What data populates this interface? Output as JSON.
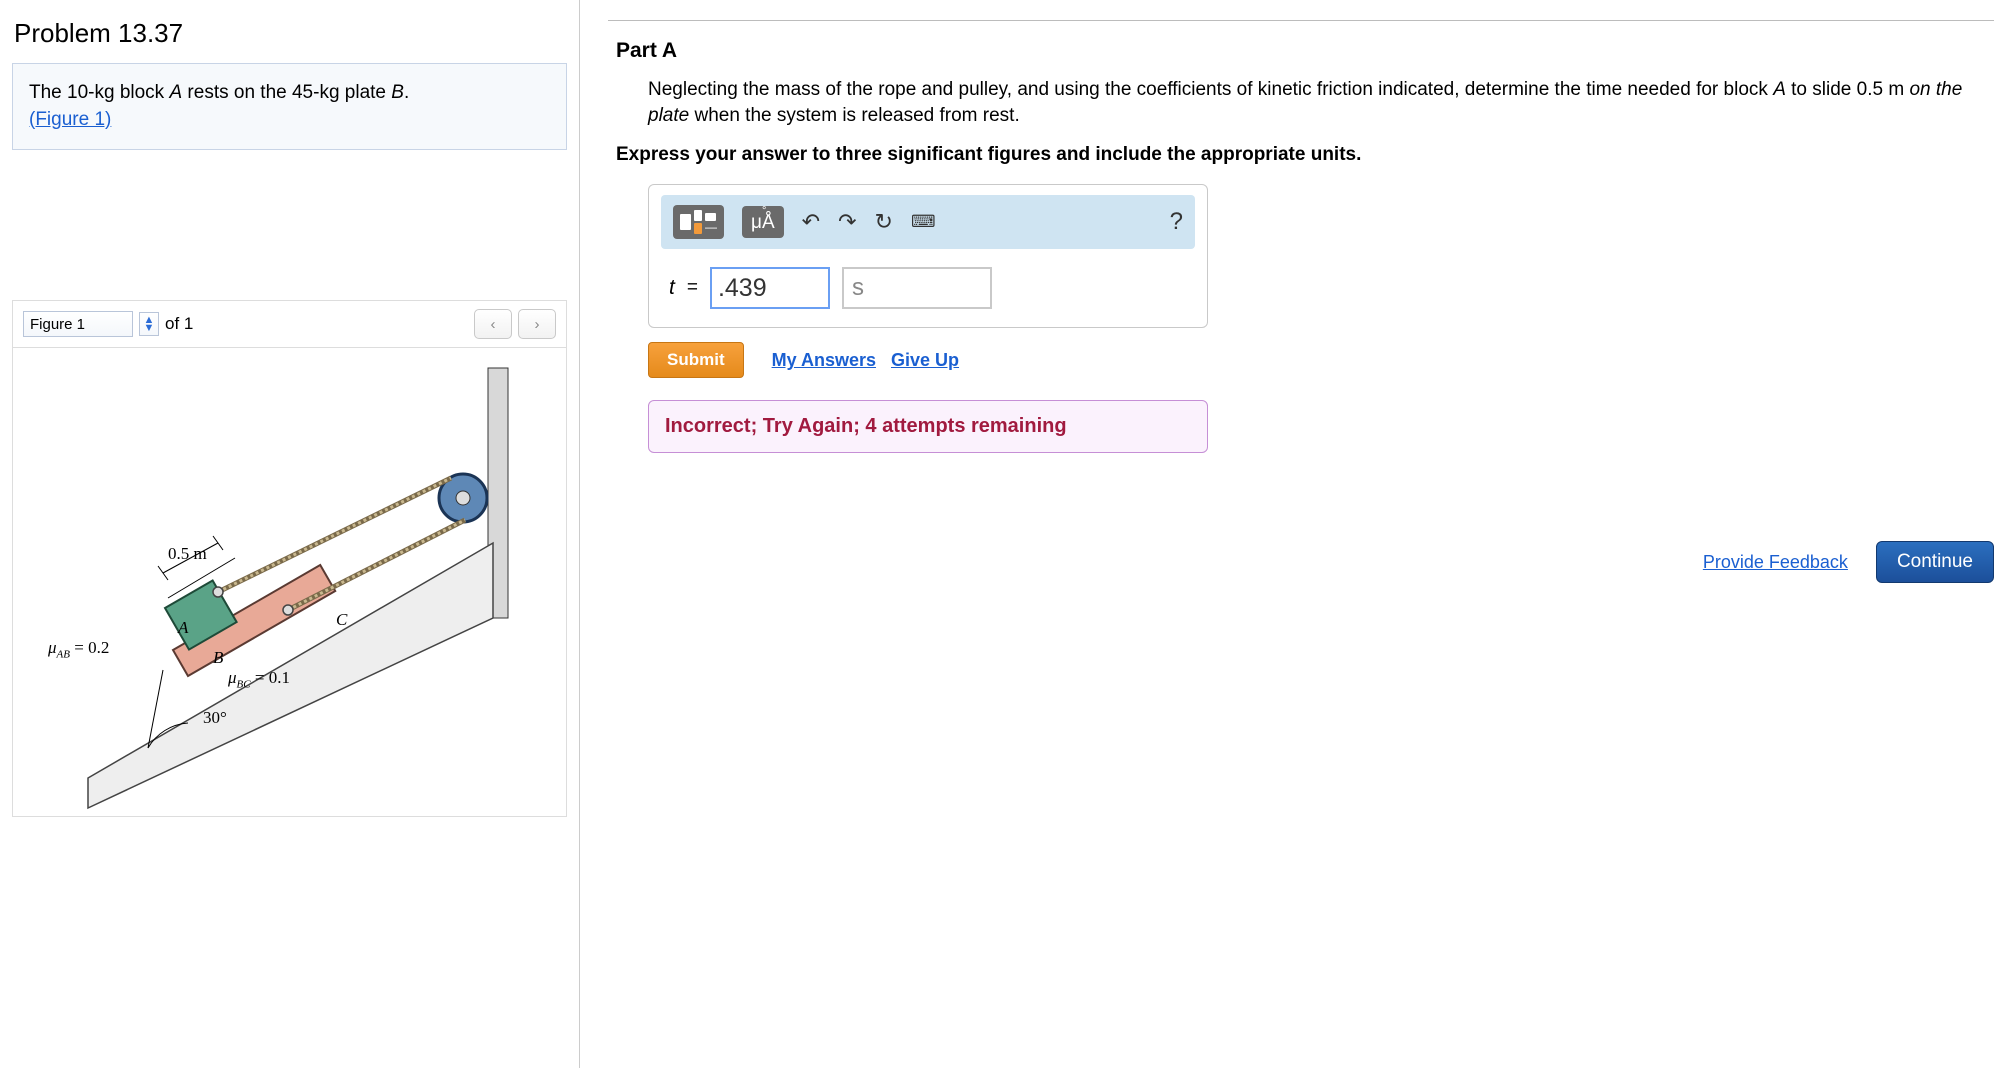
{
  "problem": {
    "title": "Problem 13.37",
    "statement_prefix": "The 10-kg block ",
    "statement_A": "A",
    "statement_mid": " rests on the 45-kg plate ",
    "statement_B": "B",
    "statement_suffix": ".",
    "figure_link": "(Figure 1)"
  },
  "figure_nav": {
    "selector_value": "Figure 1",
    "of_label": "of 1"
  },
  "figure_labels": {
    "distance": "0.5 m",
    "A": "A",
    "B": "B",
    "C": "C",
    "mu_ab": "μ",
    "mu_ab_sub": "AB",
    "mu_ab_val": " = 0.2",
    "mu_bc": "μ",
    "mu_bc_sub": "BC",
    "mu_bc_val": " = 0.1",
    "angle": "30°"
  },
  "part": {
    "label": "Part A",
    "text_1": "Neglecting the mass of the rope and pulley, and using the coefficients of kinetic friction indicated, determine the time needed for block ",
    "text_A": "A",
    "text_2": " to slide ",
    "text_dist": "0.5 m",
    "text_3": " ",
    "text_on_plate": "on the plate",
    "text_4": " when the system is released from rest.",
    "instruction": "Express your answer to three significant figures and include the appropriate units."
  },
  "toolbar": {
    "mu_label": "μÅ",
    "help": "?"
  },
  "answer": {
    "variable": "t",
    "equals": "=",
    "value": ".439",
    "unit": "s"
  },
  "actions": {
    "submit": "Submit",
    "my_answers": "My Answers",
    "give_up": "Give Up"
  },
  "feedback": {
    "message": "Incorrect; Try Again; 4 attempts remaining"
  },
  "footer": {
    "provide_feedback": "Provide Feedback",
    "continue": "Continue"
  }
}
